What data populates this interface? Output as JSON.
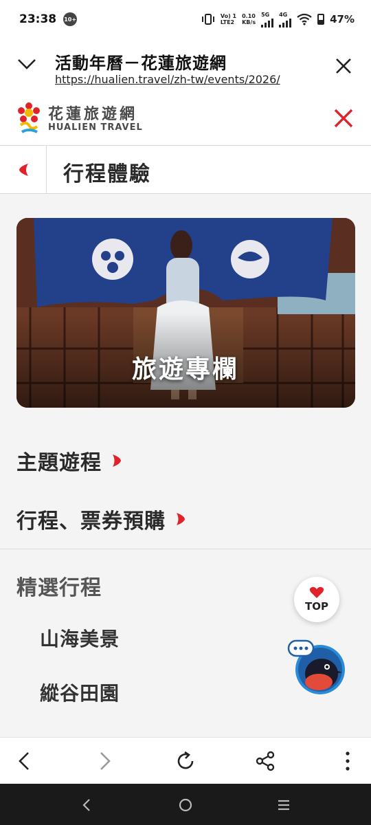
{
  "status_bar": {
    "time": "23:38",
    "notification_badge": "10+",
    "network_top": "Vo) 1",
    "network_bottom": "LTE2",
    "speed_top": "0.10",
    "speed_bottom": "KB/s",
    "sim1": "5G",
    "sim2": "4G",
    "battery": "47%"
  },
  "browser_tab": {
    "title": "活動年曆－花蓮旅遊網",
    "url": "https://hualien.travel/zh-tw/events/2026/"
  },
  "site_header": {
    "logo_zh": "花蓮旅遊網",
    "logo_en": "HUALIEN TRAVEL"
  },
  "nav_menu": {
    "back_title": "行程體驗",
    "banner_label": "旅遊專欄",
    "links": [
      {
        "label": "主題遊程"
      },
      {
        "label": "行程、票券預購"
      }
    ],
    "section_title": "精選行程",
    "sub_links": [
      {
        "label": "山海美景"
      },
      {
        "label": "縱谷田園"
      }
    ]
  },
  "floating": {
    "top_label": "TOP"
  },
  "colors": {
    "brand_red": "#e0222a",
    "banner_blue": "#23408a"
  }
}
